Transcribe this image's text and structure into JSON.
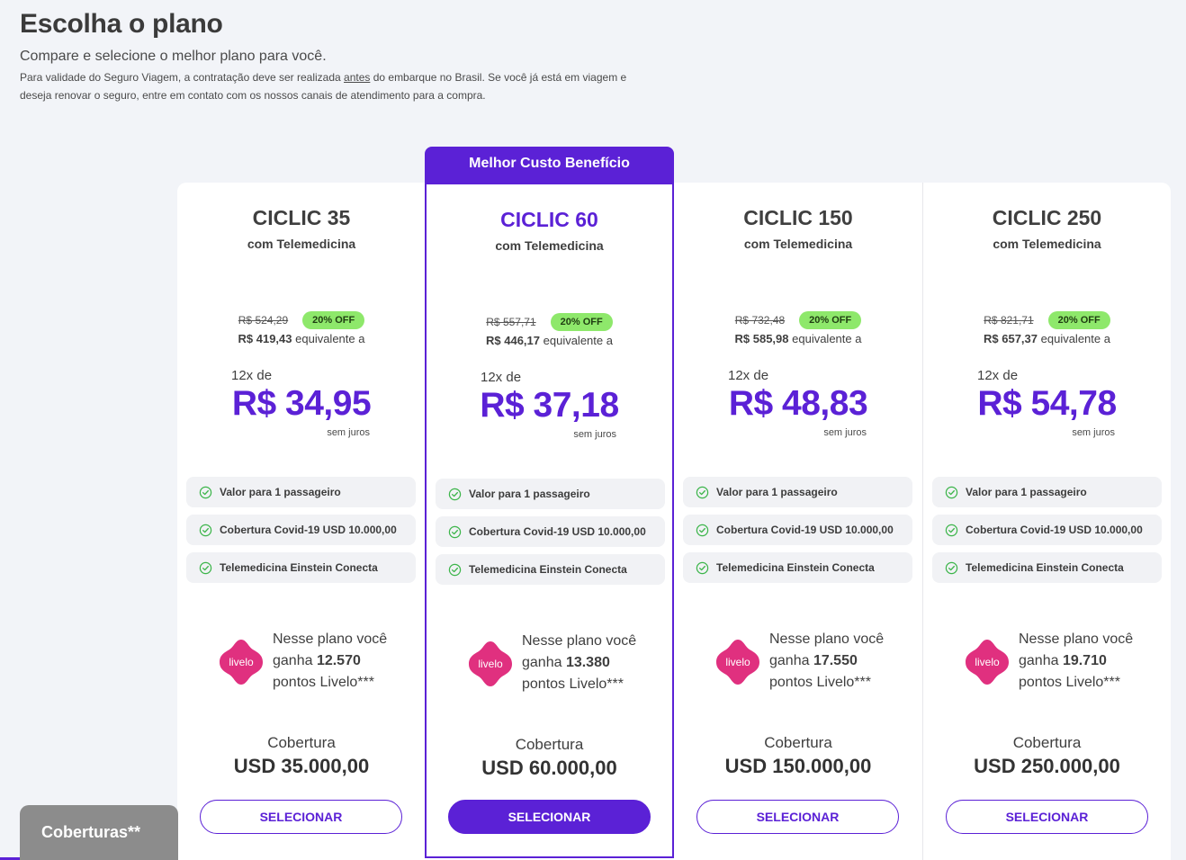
{
  "header": {
    "title": "Escolha o plano",
    "subtitle": "Compare e selecione o melhor plano para você.",
    "note_part1": "Para validade do Seguro Viagem, a contratação deve ser realizada ",
    "note_underlined": "antes",
    "note_part2": " do embarque no Brasil. Se você já está em viagem e deseja renovar o seguro, entre em contato com os nossos canais de atendimento para a compra."
  },
  "featured_banner": "Melhor Custo Benefício",
  "plans": [
    {
      "name": "CICLIC 35",
      "subtitle": "com Telemedicina",
      "old_price": "R$ 524,29",
      "discount": "20% OFF",
      "total_price": "R$ 419,43",
      "total_suffix": " equivalente a",
      "installments": "12x de",
      "installment_price": "R$ 34,95",
      "no_interest": "sem juros",
      "features": [
        "Valor para 1 passageiro",
        "Cobertura Covid-19 USD 10.000,00",
        "Telemedicina Einstein Conecta"
      ],
      "livelo_line1": "Nesse plano você",
      "livelo_prefix": "ganha ",
      "livelo_points": "12.570",
      "livelo_line3": "pontos Livelo***",
      "coverage_label": "Cobertura",
      "coverage_value": "USD 35.000,00",
      "button": "SELECIONAR"
    },
    {
      "name": "CICLIC 60",
      "subtitle": "com Telemedicina",
      "old_price": "R$ 557,71",
      "discount": "20% OFF",
      "total_price": "R$ 446,17",
      "total_suffix": " equivalente a",
      "installments": "12x de",
      "installment_price": "R$ 37,18",
      "no_interest": "sem juros",
      "features": [
        "Valor para 1 passageiro",
        "Cobertura Covid-19 USD 10.000,00",
        "Telemedicina Einstein Conecta"
      ],
      "livelo_line1": "Nesse plano você",
      "livelo_prefix": "ganha ",
      "livelo_points": "13.380",
      "livelo_line3": "pontos Livelo***",
      "coverage_label": "Cobertura",
      "coverage_value": "USD 60.000,00",
      "button": "SELECIONAR"
    },
    {
      "name": "CICLIC 150",
      "subtitle": "com Telemedicina",
      "old_price": "R$ 732,48",
      "discount": "20% OFF",
      "total_price": "R$ 585,98",
      "total_suffix": " equivalente a",
      "installments": "12x de",
      "installment_price": "R$ 48,83",
      "no_interest": "sem juros",
      "features": [
        "Valor para 1 passageiro",
        "Cobertura Covid-19 USD 10.000,00",
        "Telemedicina Einstein Conecta"
      ],
      "livelo_line1": "Nesse plano você",
      "livelo_prefix": "ganha ",
      "livelo_points": "17.550",
      "livelo_line3": "pontos Livelo***",
      "coverage_label": "Cobertura",
      "coverage_value": "USD 150.000,00",
      "button": "SELECIONAR"
    },
    {
      "name": "CICLIC 250",
      "subtitle": "com Telemedicina",
      "old_price": "R$ 821,71",
      "discount": "20% OFF",
      "total_price": "R$ 657,37",
      "total_suffix": " equivalente a",
      "installments": "12x de",
      "installment_price": "R$ 54,78",
      "no_interest": "sem juros",
      "features": [
        "Valor para 1 passageiro",
        "Cobertura Covid-19 USD 10.000,00",
        "Telemedicina Einstein Conecta"
      ],
      "livelo_line1": "Nesse plano você",
      "livelo_prefix": "ganha ",
      "livelo_points": "19.710",
      "livelo_line3": "pontos Livelo***",
      "coverage_label": "Cobertura",
      "coverage_value": "USD 250.000,00",
      "button": "SELECIONAR"
    }
  ],
  "livelo_logo_text": "livelo",
  "coverage_tab": "Coberturas**",
  "colors": {
    "accent": "#5b21d6",
    "discount_badge": "#8ee86b",
    "livelo": "#e0307f",
    "check": "#3cb54a"
  },
  "icons": {
    "feature": "check-circle-icon",
    "livelo": "livelo-logo"
  }
}
